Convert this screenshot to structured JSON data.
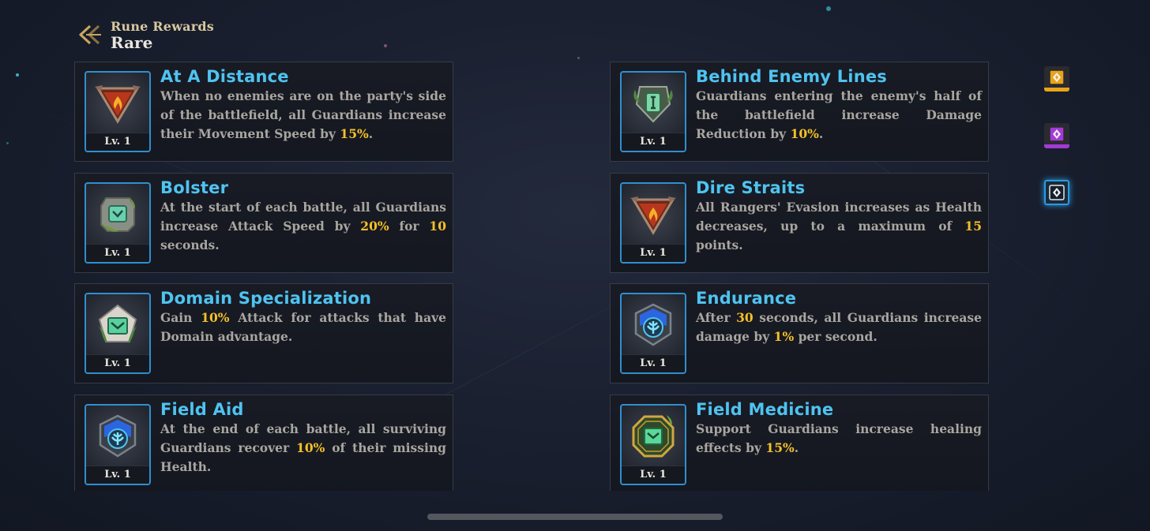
{
  "header": {
    "subtitle": "Rune Rewards",
    "title": "Rare"
  },
  "runes": [
    {
      "name": "At A Distance",
      "level": "Lv. 1",
      "icon": "red-triangle-flame-rune-icon",
      "desc": [
        {
          "t": "When no enemies are on the party's side of the battlefield, all Guardians increase their Movement Speed by "
        },
        {
          "t": "15%",
          "hl": true
        },
        {
          "t": "."
        }
      ]
    },
    {
      "name": "Behind Enemy Lines",
      "level": "Lv. 1",
      "icon": "green-leaf-shield-rune-icon",
      "desc": [
        {
          "t": "Guardians entering the enemy's half of the battlefield increase Damage Reduction by "
        },
        {
          "t": "10%",
          "hl": true
        },
        {
          "t": "."
        }
      ]
    },
    {
      "name": "Bolster",
      "level": "Lv. 1",
      "icon": "mossy-stone-rune-icon",
      "desc": [
        {
          "t": "At the start of each battle, all Guardians increase Attack Speed by "
        },
        {
          "t": "20%",
          "hl": true
        },
        {
          "t": " for "
        },
        {
          "t": "10",
          "hl": true
        },
        {
          "t": " seconds."
        }
      ]
    },
    {
      "name": "Dire Straits",
      "level": "Lv. 1",
      "icon": "red-triangle-flame-rune-icon",
      "desc": [
        {
          "t": "All Rangers' Evasion increases as Health decreases, up to a maximum of "
        },
        {
          "t": "15",
          "hl": true
        },
        {
          "t": " points."
        }
      ]
    },
    {
      "name": "Domain Specialization",
      "level": "Lv. 1",
      "icon": "green-vine-pentagon-rune-icon",
      "desc": [
        {
          "t": "Gain "
        },
        {
          "t": "10%",
          "hl": true
        },
        {
          "t": " Attack for attacks that have Domain advantage."
        }
      ]
    },
    {
      "name": "Endurance",
      "level": "Lv. 1",
      "icon": "blue-crystal-hexagon-rune-icon",
      "desc": [
        {
          "t": "After "
        },
        {
          "t": "30",
          "hl": true
        },
        {
          "t": " seconds, all Guardians increase damage by "
        },
        {
          "t": "1%",
          "hl": true
        },
        {
          "t": " per second."
        }
      ]
    },
    {
      "name": "Field Aid",
      "level": "Lv. 1",
      "icon": "blue-crystal-hexagon-rune-icon",
      "desc": [
        {
          "t": "At the end of each battle, all surviving Guardians recover "
        },
        {
          "t": "10%",
          "hl": true
        },
        {
          "t": " of their missing Health."
        }
      ]
    },
    {
      "name": "Field Medicine",
      "level": "Lv. 1",
      "icon": "gold-green-octagon-rune-icon",
      "desc": [
        {
          "t": "Support Guardians increase healing effects by "
        },
        {
          "t": "15%",
          "hl": true
        },
        {
          "t": "."
        }
      ]
    }
  ],
  "tabs": [
    {
      "name": "tab-legendary",
      "color": "#e8a418",
      "icon": "rune-diamond-icon"
    },
    {
      "name": "tab-epic",
      "color": "#a33ad6",
      "icon": "rune-diamond-icon"
    },
    {
      "name": "tab-rare",
      "color": "#2a9be0",
      "icon": "rune-diamond-icon",
      "selected": true
    }
  ],
  "colors": {
    "accent": "#4fc3f0",
    "highlight": "#f5c02a",
    "frame": "#2f8fd0"
  }
}
